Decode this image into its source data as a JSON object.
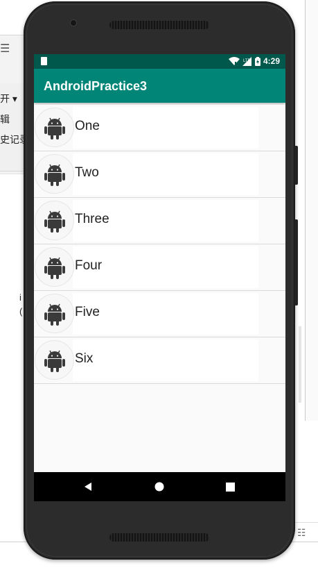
{
  "background": {
    "menu_open": "开",
    "menu_edit": "辑",
    "menu_history": "史记录",
    "fragment_1": "i",
    "fragment_2": "(",
    "hamburger_icon": "hamburger-icon",
    "grid_icon": "grid-view-icon"
  },
  "status_bar": {
    "time": "4:29",
    "icons": [
      "sim-card-icon",
      "wifi-icon",
      "lte-signal-icon",
      "battery-charging-icon"
    ],
    "lte_label": "LTE"
  },
  "app_bar": {
    "title": "AndroidPractice3"
  },
  "list": {
    "items": [
      {
        "label": "One",
        "icon": "android-icon"
      },
      {
        "label": "Two",
        "icon": "android-icon"
      },
      {
        "label": "Three",
        "icon": "android-icon"
      },
      {
        "label": "Four",
        "icon": "android-icon"
      },
      {
        "label": "Five",
        "icon": "android-icon"
      },
      {
        "label": "Six",
        "icon": "android-icon"
      }
    ]
  },
  "nav_bar": {
    "buttons": [
      "back-icon",
      "home-icon",
      "recents-icon"
    ]
  },
  "colors": {
    "primary": "#008577",
    "primary_dark": "#00574b",
    "icon": "#3a3a3a",
    "phone_body": "#2c2c2c"
  }
}
